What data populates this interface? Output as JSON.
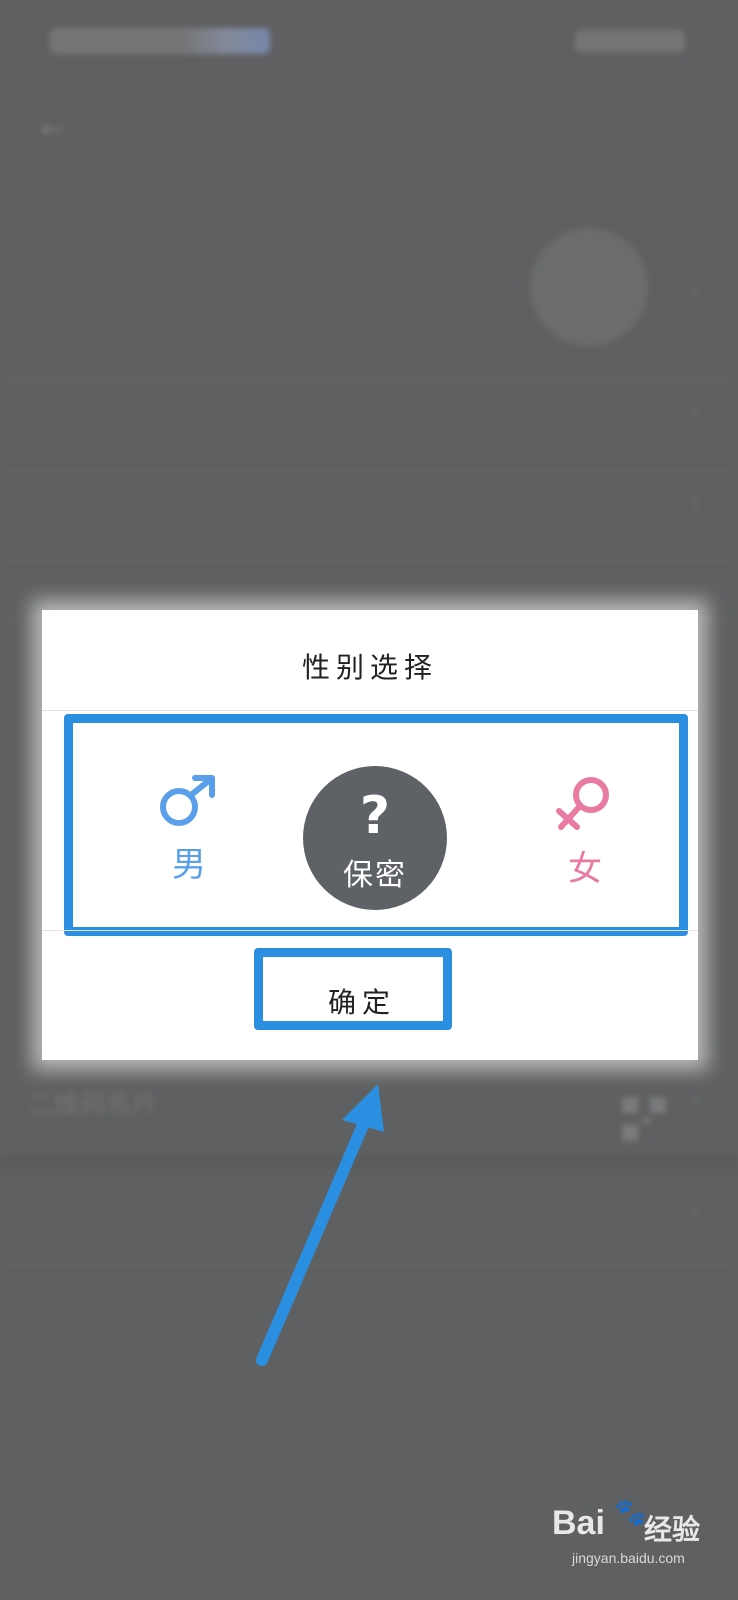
{
  "background": {
    "qr_row_label": "二维码名片"
  },
  "dialog": {
    "title": "性别选择",
    "options": {
      "male": {
        "icon": "male-symbol-icon",
        "label": "男",
        "color": "#5a9fea"
      },
      "secret": {
        "icon": "question-mark-icon",
        "glyph": "?",
        "label": "保密",
        "color": "#5e6166",
        "selected": true
      },
      "female": {
        "icon": "female-symbol-icon",
        "label": "女",
        "color": "#e97aa2"
      }
    },
    "confirm_label": "确定",
    "highlight_color": "#2a8fe0"
  },
  "watermark": {
    "brand": "Bai",
    "paw_icon": "paw-icon",
    "text": "经验",
    "url": "jingyan.baidu.com"
  }
}
